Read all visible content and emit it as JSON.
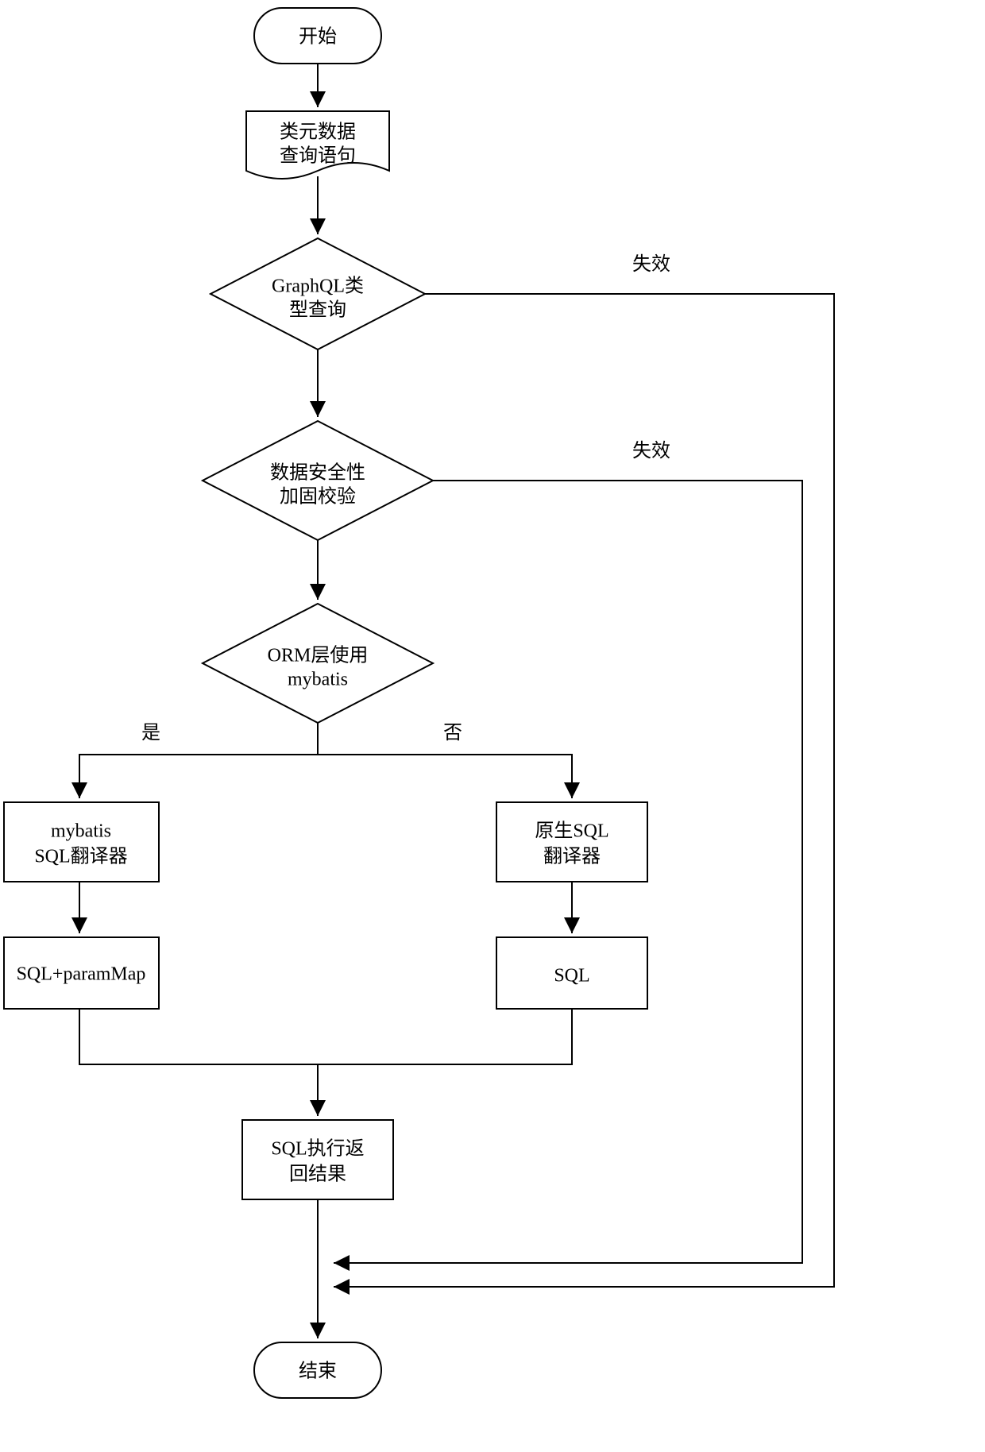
{
  "nodes": {
    "start": {
      "label": "开始"
    },
    "input": {
      "line1": "类元数据",
      "line2": "查询语句"
    },
    "decision1": {
      "line1": "GraphQL类",
      "line2": "型查询"
    },
    "decision2": {
      "line1": "数据安全性",
      "line2": "加固校验"
    },
    "decision3": {
      "line1": "ORM层使用",
      "line2": "mybatis"
    },
    "procL1": {
      "line1": "mybatis",
      "line2": "SQL翻译器"
    },
    "procR1": {
      "line1": "原生SQL",
      "line2": "翻译器"
    },
    "procL2": {
      "label": "SQL+paramMap"
    },
    "procR2": {
      "label": "SQL"
    },
    "result": {
      "line1": "SQL执行返",
      "line2": "回结果"
    },
    "end": {
      "label": "结束"
    }
  },
  "edges": {
    "fail1": "失效",
    "fail2": "失效",
    "yes": "是",
    "no": "否"
  }
}
